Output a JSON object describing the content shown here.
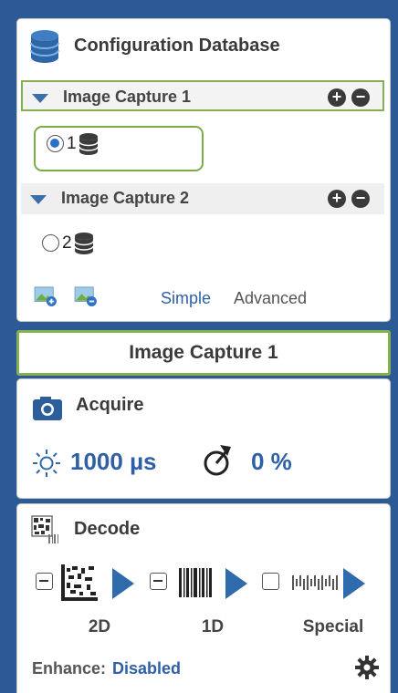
{
  "config": {
    "title": "Configuration Database",
    "groups": [
      {
        "label": "Image Capture 1",
        "add": "+",
        "remove": "−",
        "item": {
          "number": "1",
          "selected": true
        }
      },
      {
        "label": "Image Capture 2",
        "add": "+",
        "remove": "−",
        "item": {
          "number": "2",
          "selected": false
        }
      }
    ],
    "mode": {
      "simple": "Simple",
      "advanced": "Advanced"
    }
  },
  "selected_title": "Image Capture 1",
  "acquire": {
    "title": "Acquire",
    "exposure": "1000 µs",
    "gain": "0 %"
  },
  "decode": {
    "title": "Decode",
    "symbologies": [
      {
        "label": "2D",
        "state": "minus"
      },
      {
        "label": "1D",
        "state": "minus"
      },
      {
        "label": "Special",
        "state": "empty"
      }
    ],
    "enhance_label": "Enhance:",
    "enhance_value": "Disabled"
  },
  "colors": {
    "accent": "#2f5fa5",
    "selection": "#84b04f",
    "background": "#2c5a95"
  }
}
